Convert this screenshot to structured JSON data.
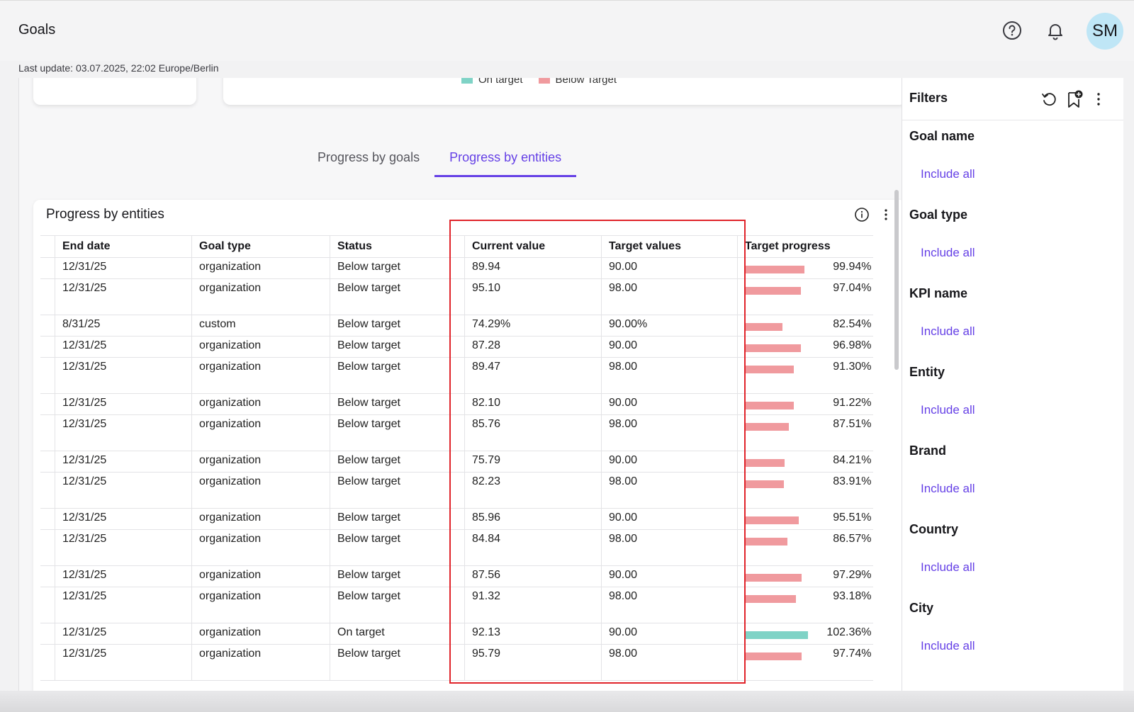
{
  "header": {
    "title": "Goals",
    "avatar_initials": "SM",
    "last_update": "Last update: 03.07.2025, 22:02 Europe/Berlin"
  },
  "legend": [
    {
      "label": "On target",
      "color": "#7fd3c6"
    },
    {
      "label": "Below Target",
      "color": "#f09a9e"
    }
  ],
  "tabs": [
    {
      "label": "Progress by goals",
      "active": false
    },
    {
      "label": "Progress by entities",
      "active": true
    }
  ],
  "table": {
    "title": "Progress by entities",
    "columns": [
      "End date",
      "Goal type",
      "Status",
      "Current value",
      "Target values",
      "Target progress"
    ],
    "rows": [
      {
        "end": "12/31/25",
        "type": "organization",
        "status": "Below target",
        "current": "89.94",
        "target": "90.00",
        "progress": "99.94%",
        "fraction": 0.9994,
        "on_target": false,
        "tall": false
      },
      {
        "end": "12/31/25",
        "type": "organization",
        "status": "Below target",
        "current": "95.10",
        "target": "98.00",
        "progress": "97.04%",
        "fraction": 0.9704,
        "on_target": false,
        "tall": true
      },
      {
        "end": "8/31/25",
        "type": "custom",
        "status": "Below target",
        "current": "74.29%",
        "target": "90.00%",
        "progress": "82.54%",
        "fraction": 0.8254,
        "on_target": false,
        "tall": false
      },
      {
        "end": "12/31/25",
        "type": "organization",
        "status": "Below target",
        "current": "87.28",
        "target": "90.00",
        "progress": "96.98%",
        "fraction": 0.9698,
        "on_target": false,
        "tall": false
      },
      {
        "end": "12/31/25",
        "type": "organization",
        "status": "Below target",
        "current": "89.47",
        "target": "98.00",
        "progress": "91.30%",
        "fraction": 0.913,
        "on_target": false,
        "tall": true
      },
      {
        "end": "12/31/25",
        "type": "organization",
        "status": "Below target",
        "current": "82.10",
        "target": "90.00",
        "progress": "91.22%",
        "fraction": 0.9122,
        "on_target": false,
        "tall": false
      },
      {
        "end": "12/31/25",
        "type": "organization",
        "status": "Below target",
        "current": "85.76",
        "target": "98.00",
        "progress": "87.51%",
        "fraction": 0.8751,
        "on_target": false,
        "tall": true
      },
      {
        "end": "12/31/25",
        "type": "organization",
        "status": "Below target",
        "current": "75.79",
        "target": "90.00",
        "progress": "84.21%",
        "fraction": 0.8421,
        "on_target": false,
        "tall": false
      },
      {
        "end": "12/31/25",
        "type": "organization",
        "status": "Below target",
        "current": "82.23",
        "target": "98.00",
        "progress": "83.91%",
        "fraction": 0.8391,
        "on_target": false,
        "tall": true
      },
      {
        "end": "12/31/25",
        "type": "organization",
        "status": "Below target",
        "current": "85.96",
        "target": "90.00",
        "progress": "95.51%",
        "fraction": 0.9551,
        "on_target": false,
        "tall": false
      },
      {
        "end": "12/31/25",
        "type": "organization",
        "status": "Below target",
        "current": "84.84",
        "target": "98.00",
        "progress": "86.57%",
        "fraction": 0.8657,
        "on_target": false,
        "tall": true
      },
      {
        "end": "12/31/25",
        "type": "organization",
        "status": "Below target",
        "current": "87.56",
        "target": "90.00",
        "progress": "97.29%",
        "fraction": 0.9729,
        "on_target": false,
        "tall": false
      },
      {
        "end": "12/31/25",
        "type": "organization",
        "status": "Below target",
        "current": "91.32",
        "target": "98.00",
        "progress": "93.18%",
        "fraction": 0.9318,
        "on_target": false,
        "tall": true
      },
      {
        "end": "12/31/25",
        "type": "organization",
        "status": "On target",
        "current": "92.13",
        "target": "90.00",
        "progress": "102.36%",
        "fraction": 1.0236,
        "on_target": true,
        "tall": false
      },
      {
        "end": "12/31/25",
        "type": "organization",
        "status": "Below target",
        "current": "95.79",
        "target": "98.00",
        "progress": "97.74%",
        "fraction": 0.9774,
        "on_target": false,
        "tall": true
      }
    ]
  },
  "filters": {
    "title": "Filters",
    "sections": [
      {
        "label": "Goal name",
        "link": "Include all"
      },
      {
        "label": "Goal type",
        "link": "Include all"
      },
      {
        "label": "KPI name",
        "link": "Include all"
      },
      {
        "label": "Entity",
        "link": "Include all"
      },
      {
        "label": "Brand",
        "link": "Include all"
      },
      {
        "label": "Country",
        "link": "Include all"
      },
      {
        "label": "City",
        "link": "Include all"
      }
    ]
  },
  "colors": {
    "accent": "#6540e6",
    "below_target": "#f09a9e",
    "on_target": "#7fd3c6",
    "highlight": "#e0232a"
  }
}
